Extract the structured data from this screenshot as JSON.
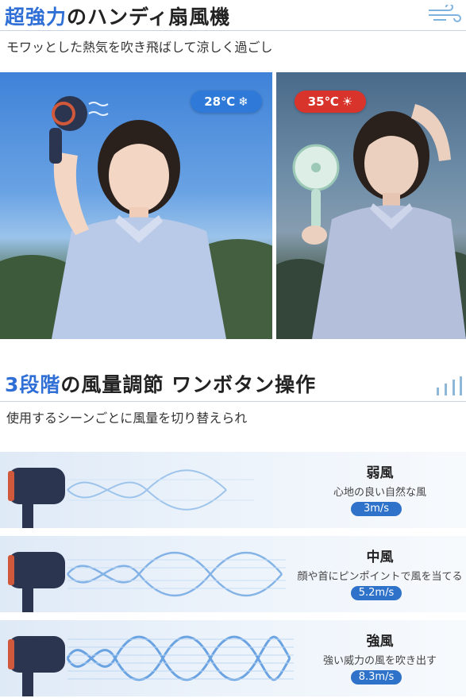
{
  "header": {
    "title_accent": "超強力",
    "title_rest": "のハンディ扇風機",
    "subtitle": "モワッとした熱気を吹き飛ばして涼しく過ごし"
  },
  "photos": {
    "left_badge": "28℃",
    "right_badge": "35℃"
  },
  "section2": {
    "title_accent": "3段階",
    "title_rest": "の風量調節 ワンボタン操作",
    "subtitle": "使用するシーンごとに風量を切り替えられ"
  },
  "modes": [
    {
      "title": "弱風",
      "desc": "心地の良い自然な風",
      "speed": "3m/s",
      "intensity": 1
    },
    {
      "title": "中風",
      "desc": "顔や首にピンポイントで風を当てる",
      "speed": "5.2m/s",
      "intensity": 2
    },
    {
      "title": "強風",
      "desc": "強い威力の風を吹き出す",
      "speed": "8.3m/s",
      "intensity": 3
    }
  ],
  "colors": {
    "accent": "#2f6fd6",
    "cold_badge": "#2f7ad8",
    "hot_badge": "#d9342b",
    "fan_body": "#2b3550",
    "fan_ring": "#d0583b"
  }
}
